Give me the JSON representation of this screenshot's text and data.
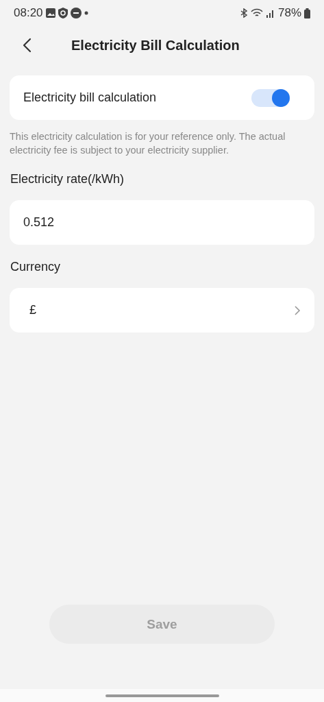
{
  "status_bar": {
    "time": "08:20",
    "battery": "78%"
  },
  "header": {
    "title": "Electricity Bill Calculation"
  },
  "toggle_card": {
    "label": "Electricity bill calculation",
    "on": true
  },
  "note": "This electricity calculation is for your reference only. The actual electricity fee is subject to your electricity supplier.",
  "rate": {
    "label": "Electricity rate(/kWh)",
    "value": "0.512"
  },
  "currency": {
    "label": "Currency",
    "value": "£"
  },
  "save_button": {
    "label": "Save",
    "disabled": true
  }
}
